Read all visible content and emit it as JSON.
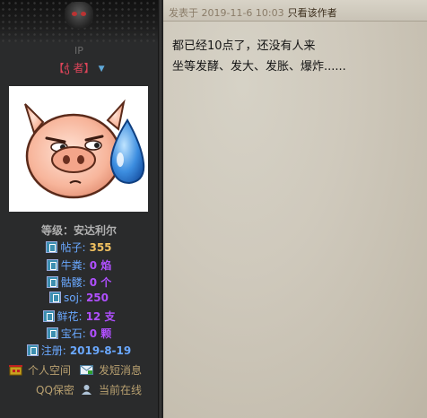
{
  "user": {
    "ip_label": "IP",
    "username": "【ჭ 者】",
    "rank": "等级：安达利尔",
    "stats": [
      {
        "icon": "post-icon",
        "label": "帖子:",
        "value": "355",
        "color": "gold"
      },
      {
        "icon": "money-icon",
        "label": "牛粪:",
        "value": "0 焰",
        "color": "purple"
      },
      {
        "icon": "money-icon",
        "label": "骷髅:",
        "value": "0 个",
        "color": "purple"
      },
      {
        "icon": "money-icon",
        "label": "soj:",
        "value": "250",
        "color": "purple"
      },
      {
        "icon": "money-icon",
        "label": "鲜花:",
        "value": "12 支",
        "color": "purple"
      },
      {
        "icon": "money-icon",
        "label": "宝石:",
        "value": "0 颗",
        "color": "purple"
      },
      {
        "icon": "calendar-icon",
        "label": "注册:",
        "value": "2019-8-19",
        "color": "blue"
      }
    ],
    "links": {
      "profile": "个人空间",
      "message": "发短消息",
      "qq": "QQ保密",
      "online": "当前在线"
    }
  },
  "post": {
    "meta": "发表于 2019-11-6 10:03",
    "only_author": "只看该作者",
    "lines": [
      "都已经10点了，还没有人来",
      "坐等发酵、发大、发胀、爆炸......"
    ]
  },
  "colors": {
    "username": "#e0455a",
    "stat_label": "#6aa8ff",
    "value_gold": "#f0c060",
    "value_purple": "#b050ff",
    "link": "#b8a070"
  }
}
